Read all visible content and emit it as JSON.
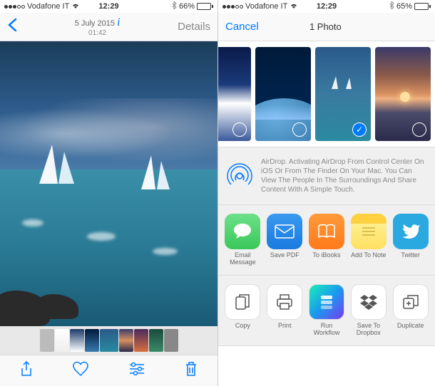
{
  "left": {
    "status": {
      "carrier": "Vodafone IT",
      "time": "12:29",
      "bluetooth": "*",
      "battery_pct": "66%"
    },
    "nav": {
      "date": "5 July 2015",
      "time": "01:42",
      "details_label": "Details"
    },
    "toolbar": {
      "share": "share-icon",
      "favorite": "heart-icon",
      "edit": "sliders-icon",
      "delete": "trash-icon"
    }
  },
  "right": {
    "status": {
      "carrier": "Vodafone IT",
      "time": "12:29",
      "bluetooth": "*",
      "battery_pct": "65%"
    },
    "nav": {
      "cancel": "Cancel",
      "count": "1 Photo"
    },
    "airdrop": {
      "text": "AirDrop. Activating AirDrop From Control Center On iOS Or From The Finder On Your Mac. You Can View The People In The Surroundings And Share Content With A Simple Touch."
    },
    "share_apps": [
      {
        "name": "message",
        "label": "Email Message"
      },
      {
        "name": "mail",
        "label": "Save PDF"
      },
      {
        "name": "ibooks",
        "label": "To iBooks"
      },
      {
        "name": "notes",
        "label": "Add To Note"
      },
      {
        "name": "twitter",
        "label": "Twitter"
      }
    ],
    "actions": [
      {
        "name": "copy",
        "label": "Copy"
      },
      {
        "name": "print",
        "label": "Print"
      },
      {
        "name": "workflow",
        "label": "Run Workflow"
      },
      {
        "name": "dropbox",
        "label": "Save To Dropbox"
      },
      {
        "name": "duplicate",
        "label": "Duplicate"
      }
    ]
  },
  "colors": {
    "ios_blue": "#007aff",
    "ios_green": "#4cd964"
  }
}
